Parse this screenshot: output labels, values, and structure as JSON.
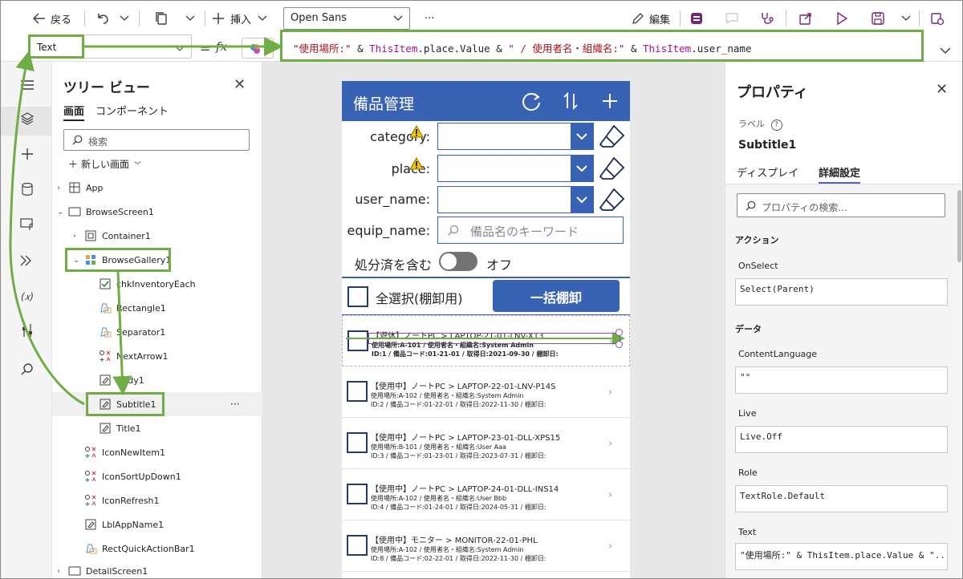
{
  "toolbar": {
    "back_label": "戻る",
    "insert_label": "挿入",
    "font": "Open Sans",
    "more_label": "···",
    "edit_label": "編集"
  },
  "formula_bar": {
    "property": "Text",
    "fx_label": "=",
    "formula_parts": [
      {
        "text": "\"使用場所:\"",
        "color": "#a31515"
      },
      {
        "text": " & ",
        "color": "#242424"
      },
      {
        "text": "ThisItem",
        "color": "#a0138e"
      },
      {
        "text": ".place.Value & ",
        "color": "#242424"
      },
      {
        "text": "\" / 使用者名・組織名:\"",
        "color": "#a31515"
      },
      {
        "text": " & ",
        "color": "#242424"
      },
      {
        "text": "ThisItem",
        "color": "#a0138e"
      },
      {
        "text": ".user_name",
        "color": "#242424"
      }
    ]
  },
  "tree": {
    "title": "ツリー ビュー",
    "tab_screens": "画面",
    "tab_components": "コンポーネント",
    "search_placeholder": "検索",
    "new_screen": "新しい画面",
    "nodes": [
      {
        "label": "App",
        "icon": "app-icon"
      },
      {
        "label": "BrowseScreen1",
        "icon": "screen-icon"
      },
      {
        "label": "Container1",
        "icon": "container-icon"
      },
      {
        "label": "BrowseGallery1",
        "icon": "gallery-icon"
      },
      {
        "label": "chkInventoryEach",
        "icon": "checkbox-icon"
      },
      {
        "label": "Rectangle1",
        "icon": "rectangle-icon"
      },
      {
        "label": "Separator1",
        "icon": "rectangle-icon"
      },
      {
        "label": "NextArrow1",
        "icon": "icons-icon"
      },
      {
        "label": "Body1",
        "icon": "label-icon"
      },
      {
        "label": "Subtitle1",
        "icon": "label-icon"
      },
      {
        "label": "Title1",
        "icon": "label-icon"
      },
      {
        "label": "IconNewItem1",
        "icon": "icons-icon"
      },
      {
        "label": "IconSortUpDown1",
        "icon": "icons-icon"
      },
      {
        "label": "IconRefresh1",
        "icon": "icons-icon"
      },
      {
        "label": "LblAppName1",
        "icon": "label-icon"
      },
      {
        "label": "RectQuickActionBar1",
        "icon": "rectangle-icon"
      },
      {
        "label": "DetailScreen1",
        "icon": "screen-icon"
      }
    ],
    "selected_more": "···"
  },
  "app": {
    "title": "備品管理",
    "filters": {
      "category": "category:",
      "place": "place:",
      "user_name": "user_name:",
      "equip_name": "equip_name:",
      "keyword_placeholder": "備品名のキーワード",
      "disposed_label": "処分済を含む",
      "toggle_state": "オフ"
    },
    "select_all": "全選択(棚卸用)",
    "bulk_button": "一括棚卸",
    "items": [
      {
        "title": "【遊休】ノートPC > LAPTOP-21-01-LNV-X13",
        "subtitle": "使用場所:A-101 / 使用者名・組織名:System Admin",
        "body": "ID:1 / 備品コード:01-21-01 / 取得日:2021-09-30 / 棚卸日:"
      },
      {
        "title": "【使用中】ノートPC > LAPTOP-22-01-LNV-P14S",
        "subtitle": "使用場所:A-102 / 使用者名・組織名:System Admin",
        "body": "ID:2 / 備品コード:01-22-01 / 取得日:2022-11-30 / 棚卸日:"
      },
      {
        "title": "【使用中】ノートPC > LAPTOP-23-01-DLL-XPS15",
        "subtitle": "使用場所:B-101 / 使用者名・組織名:User Aaa",
        "body": "ID:3 / 備品コード:01-23-01 / 取得日:2023-07-31 / 棚卸日:"
      },
      {
        "title": "【使用中】ノートPC > LAPTOP-24-01-DLL-INS14",
        "subtitle": "使用場所:A-102 / 使用者名・組織名:User Bbb",
        "body": "ID:4 / 備品コード:01-24-01 / 取得日:2024-05-31 / 棚卸日:"
      },
      {
        "title": "【使用中】モニター > MONITOR-22-01-PHL",
        "subtitle": "使用場所:A-102 / 使用者名・組織名:System Admin",
        "body": "ID:8 / 備品コード:02-22-01 / 取得日:2022-11-30 / 棚卸日:"
      }
    ]
  },
  "properties": {
    "title": "プロパティ",
    "type_label": "ラベル",
    "control_name": "Subtitle1",
    "tab_display": "ディスプレイ",
    "tab_advanced": "詳細設定",
    "search_placeholder": "プロパティの検索...",
    "section_action": "アクション",
    "section_data": "データ",
    "fields": [
      {
        "label": "OnSelect",
        "value": "Select(Parent)"
      },
      {
        "label": "ContentLanguage",
        "value": "\"\""
      },
      {
        "label": "Live",
        "value": "Live.Off"
      },
      {
        "label": "Role",
        "value": "TextRole.Default"
      },
      {
        "label": "Text",
        "value": "\"使用場所:\" & ThisItem.place.Value & \"..."
      }
    ]
  },
  "colors": {
    "accent": "#3862b3",
    "highlight": "#70ad47",
    "brand_purple": "#742774"
  }
}
